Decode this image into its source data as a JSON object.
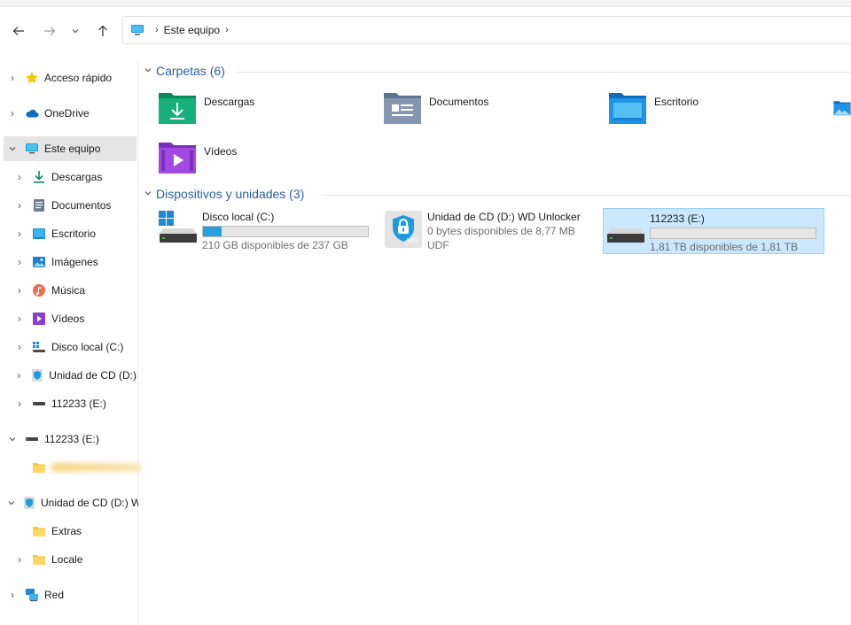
{
  "address": {
    "crumbs": [
      "Este equipo"
    ]
  },
  "sidebar": {
    "items": [
      {
        "label": "Acceso rápido"
      },
      {
        "label": "OneDrive"
      },
      {
        "label": "Este equipo"
      },
      {
        "label": "Descargas"
      },
      {
        "label": "Documentos"
      },
      {
        "label": "Escritorio"
      },
      {
        "label": "Imágenes"
      },
      {
        "label": "Música"
      },
      {
        "label": "Vídeos"
      },
      {
        "label": "Disco local (C:)"
      },
      {
        "label": "Unidad de CD (D:)"
      },
      {
        "label": "112233 (E:)"
      },
      {
        "label": "112233 (E:)"
      },
      {
        "label": ""
      },
      {
        "label": "Unidad de CD (D:) WD Unlocker"
      },
      {
        "label": "Extras"
      },
      {
        "label": "Locale"
      },
      {
        "label": "Red"
      }
    ]
  },
  "groups": {
    "folders_header": "Carpetas (6)",
    "devices_header": "Dispositivos y unidades (3)"
  },
  "folders": [
    {
      "name": "Descargas",
      "icon": "downloads-folder-icon"
    },
    {
      "name": "Documentos",
      "icon": "documents-folder-icon"
    },
    {
      "name": "Escritorio",
      "icon": "desktop-folder-icon"
    },
    {
      "name": "",
      "icon": "pictures-folder-icon"
    },
    {
      "name": "Vídeos",
      "icon": "videos-folder-icon"
    }
  ],
  "drives": [
    {
      "name": "Disco local (C:)",
      "usage": 0.114,
      "free_text": "210 GB disponibles de 237 GB"
    },
    {
      "name": "Unidad de CD (D:) WD Unlocker",
      "line2": "0 bytes disponibles de 8,77 MB",
      "line3": "UDF"
    },
    {
      "name": "112233 (E:)",
      "usage": 0.0,
      "free_text": "1,81 TB disponibles de 1,81 TB"
    }
  ],
  "colors": {
    "accent": "#26a0da",
    "header_blue": "#2b5fa8",
    "selection": "#cce8ff"
  }
}
